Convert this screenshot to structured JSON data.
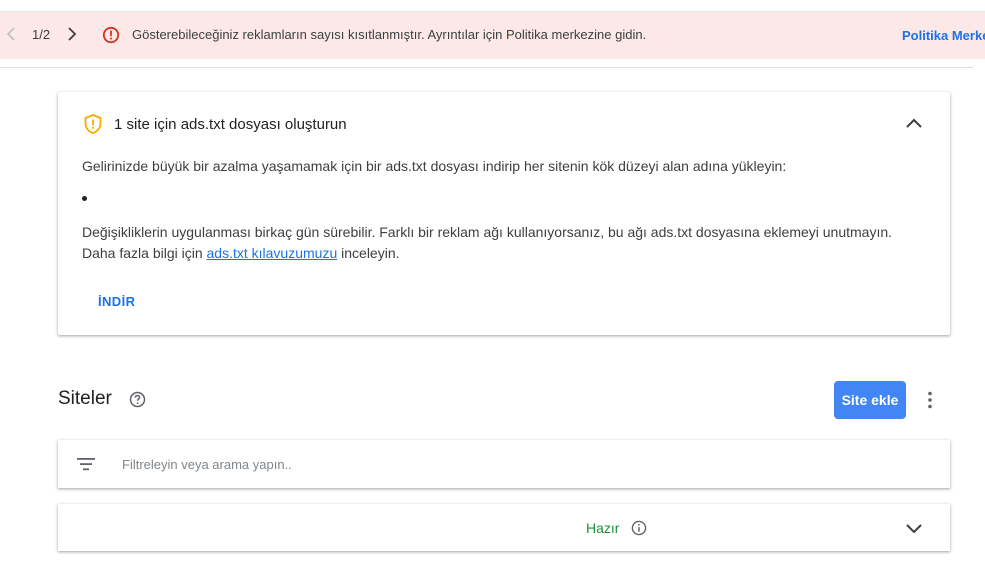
{
  "banner": {
    "pager_count": "1/2",
    "message": "Gösterebileceğiniz reklamların sayısı kısıtlanmıştır. Ayrıntılar için Politika merkezine gidin.",
    "link_label": "Politika Merke",
    "background_color": "#fce8e6",
    "error_color": "#d93025",
    "icons": {
      "prev": "chevron-left-icon",
      "next": "chevron-right-icon",
      "error": "error-circle-icon"
    }
  },
  "ads_card": {
    "title": "1 site için ads.txt dosyası oluşturun",
    "description": "Gelirinizde büyük bir azalma yaşamamak için bir ads.txt dosyası indirip her sitenin kök düzeyi alan adına yükleyin:",
    "note_line1": "Değişikliklerin uygulanması birkaç gün sürebilir. Farklı bir reklam ağı kullanıyorsanız, bu ağı ads.txt dosyasına eklemeyi unutmayın.",
    "note_line2_prefix": "Daha fazla bilgi için",
    "note_link": "ads.txt kılavuzumuzu",
    "note_line2_suffix": "inceleyin.",
    "download_label": "İNDİR",
    "warning_color": "#f9ab00",
    "icons": {
      "shield": "shield-warning-icon",
      "collapse": "chevron-up-icon"
    }
  },
  "sites": {
    "title": "Siteler",
    "add_button": "Site ekle",
    "accent_color": "#4285f4",
    "filter_placeholder": "Filtreleyin veya arama yapın..",
    "status_label": "Hazır",
    "status_color": "#1e8e3e",
    "icons": {
      "help": "help-circle-icon",
      "more": "more-vert-icon",
      "filter": "filter-list-icon",
      "info": "info-icon",
      "expand": "chevron-down-icon"
    }
  }
}
